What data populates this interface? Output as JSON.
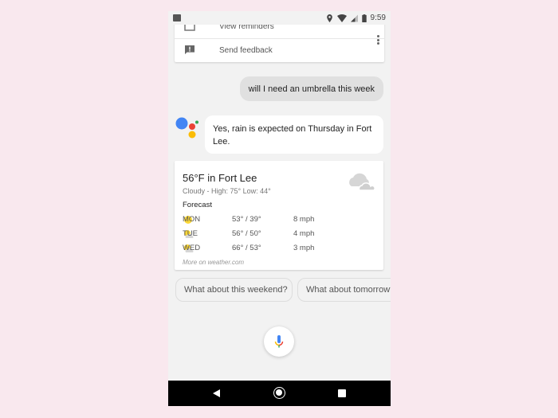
{
  "status_bar": {
    "time": "9:59",
    "icons": [
      "image-icon",
      "location-icon",
      "wifi-icon",
      "signal-icon",
      "battery-icon"
    ]
  },
  "menu": {
    "items": [
      {
        "label": "View reminders",
        "icon": "reminder-icon"
      },
      {
        "label": "Send feedback",
        "icon": "feedback-icon"
      }
    ],
    "overflow_icon": "more-vert-icon"
  },
  "conversation": {
    "user_query": "will I need an umbrella this week",
    "assistant_reply": "Yes, rain is expected on Thursday in Fort Lee."
  },
  "weather": {
    "title": "56°F in Fort Lee",
    "subtitle": "Cloudy - High: 75° Low: 44°",
    "condition_icon": "cloudy-icon",
    "forecast_label": "Forecast",
    "forecast": [
      {
        "day": "MON",
        "temps": "53° / 39°",
        "wind": "8 mph",
        "icon": "sunny-icon"
      },
      {
        "day": "TUE",
        "temps": "56° / 50°",
        "wind": "4 mph",
        "icon": "partly-cloudy-icon"
      },
      {
        "day": "WED",
        "temps": "66° / 53°",
        "wind": "3 mph",
        "icon": "partly-cloudy-icon"
      }
    ],
    "source": "More on weather.com"
  },
  "suggestions": [
    {
      "label": "What about this weekend?"
    },
    {
      "label": "What about tomorrow?"
    }
  ],
  "colors": {
    "google_blue": "#4285f4",
    "google_red": "#ea4335",
    "google_yellow": "#fbbc05",
    "google_green": "#34a853",
    "sun_yellow": "#fdd835",
    "page_background": "#f9e8ee"
  }
}
